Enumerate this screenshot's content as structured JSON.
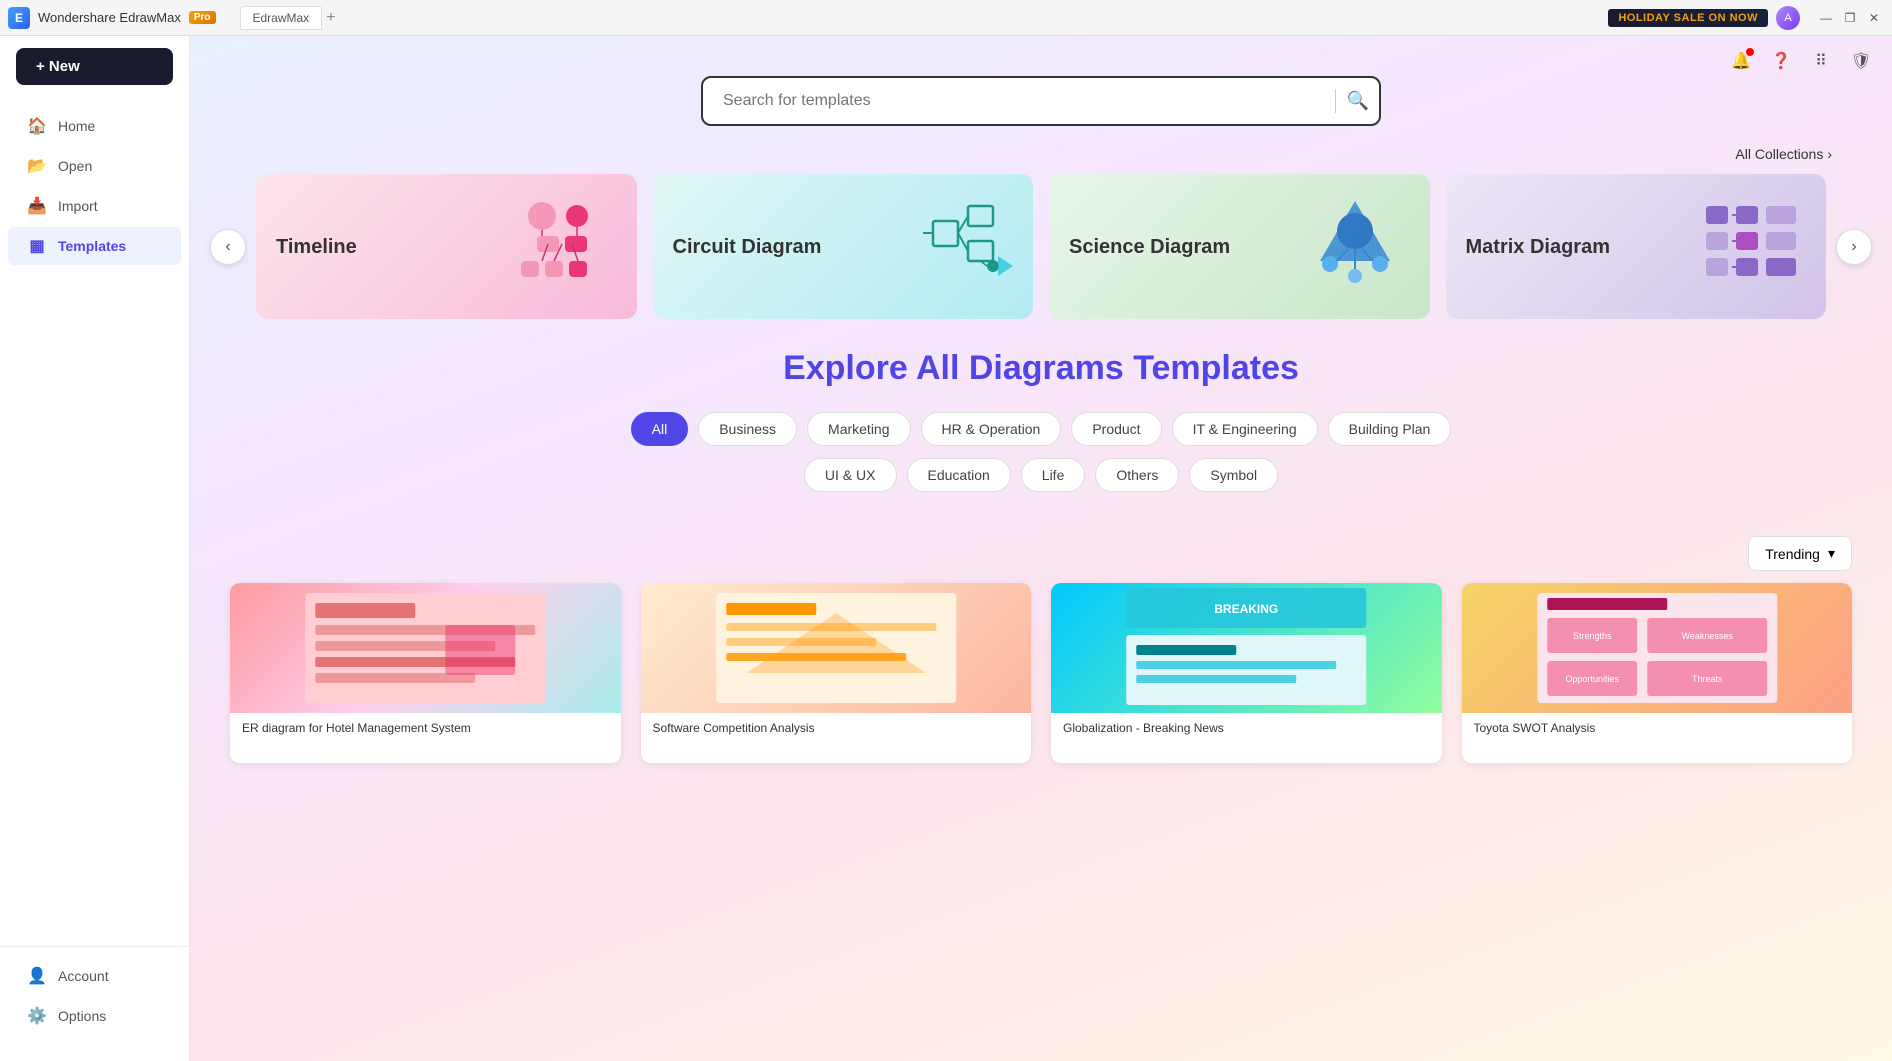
{
  "titleBar": {
    "appName": "Wondershare EdrawMax",
    "badge": "Pro",
    "tabName": "+",
    "holidayBanner": "HOLIDAY SALE ON NOW",
    "windowControls": {
      "minimize": "—",
      "maximize": "❐",
      "close": "✕"
    }
  },
  "sidebar": {
    "newButton": "+ New",
    "navItems": [
      {
        "id": "home",
        "label": "Home",
        "icon": "🏠"
      },
      {
        "id": "open",
        "label": "Open",
        "icon": "📂"
      },
      {
        "id": "import",
        "label": "Import",
        "icon": "📥"
      },
      {
        "id": "templates",
        "label": "Templates",
        "icon": "▦",
        "active": true
      }
    ],
    "bottomItems": [
      {
        "id": "account",
        "label": "Account",
        "icon": "👤"
      },
      {
        "id": "options",
        "label": "Options",
        "icon": "⚙️"
      }
    ]
  },
  "search": {
    "placeholder": "Search for templates"
  },
  "carousel": {
    "allCollections": "All Collections",
    "cards": [
      {
        "id": "timeline",
        "label": "Timeline",
        "bg": "card-timeline"
      },
      {
        "id": "circuit",
        "label": "Circuit Diagram",
        "bg": "card-circuit"
      },
      {
        "id": "science",
        "label": "Science Diagram",
        "bg": "card-science"
      },
      {
        "id": "matrix",
        "label": "Matrix Diagram",
        "bg": "card-matrix"
      }
    ]
  },
  "explore": {
    "titlePart1": "Explore ",
    "titlePart2": "All Diagrams Templates",
    "filters": [
      {
        "id": "all",
        "label": "All",
        "active": true
      },
      {
        "id": "business",
        "label": "Business",
        "active": false
      },
      {
        "id": "marketing",
        "label": "Marketing",
        "active": false
      },
      {
        "id": "hr-operation",
        "label": "HR & Operation",
        "active": false
      },
      {
        "id": "product",
        "label": "Product",
        "active": false
      },
      {
        "id": "it-engineering",
        "label": "IT & Engineering",
        "active": false
      },
      {
        "id": "building-plan",
        "label": "Building Plan",
        "active": false
      }
    ],
    "filters2": [
      {
        "id": "ui-ux",
        "label": "UI & UX",
        "active": false
      },
      {
        "id": "education",
        "label": "Education",
        "active": false
      },
      {
        "id": "life",
        "label": "Life",
        "active": false
      },
      {
        "id": "others",
        "label": "Others",
        "active": false
      },
      {
        "id": "symbol",
        "label": "Symbol",
        "active": false
      }
    ],
    "sortLabel": "Trending",
    "sortArrow": "▾"
  },
  "templates": [
    {
      "id": "t1",
      "name": "ER diagram for Hotel Management System",
      "thumbClass": "thumb-1"
    },
    {
      "id": "t2",
      "name": "Software Competition Analysis",
      "thumbClass": "thumb-2"
    },
    {
      "id": "t3",
      "name": "Globalization - Breaking News",
      "thumbClass": "thumb-3"
    },
    {
      "id": "t4",
      "name": "Toyota SWOT Analysis",
      "thumbClass": "thumb-4"
    }
  ]
}
